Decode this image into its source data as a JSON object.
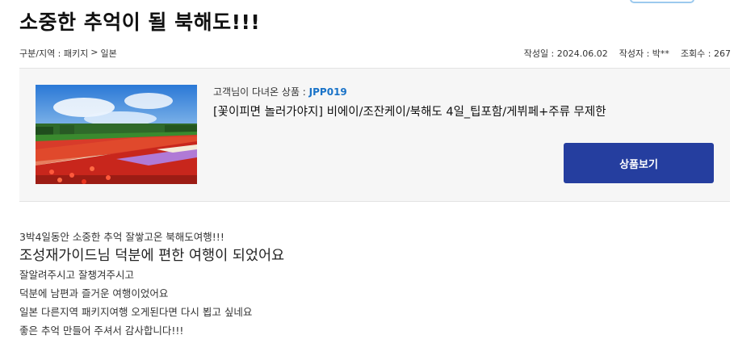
{
  "post": {
    "title": "소중한 추억이 될 북해도!!!",
    "breadcrumb": {
      "category": "구분/지역 : 패키지",
      "separator": ">",
      "region": "일본"
    },
    "date_label": "작성일 : 2024.06.02",
    "author_label": "작성자 : 박**",
    "views_label": "조회수 : 267"
  },
  "product": {
    "visited_label": "고객님이 다녀온 상품 : ",
    "code": "JPP019",
    "name": "[꽃이피면 놀러가야지] 비에이/조잔케이/북해도 4일_팁포함/게뷔페+주류 무제한",
    "button_label": "상품보기",
    "image_desc": "flower-field-photo"
  },
  "content": {
    "lines": [
      "3박4일동안 소중한 추억 잘쌓고온 북해도여행!!!",
      "조성재가이드님 덕분에 편한 여행이 되었어요",
      "잘알려주시고 잘챙겨주시고",
      "덕분에 남편과 즐거운 여행이었어요",
      "일본 다른지역 패키지여행 오게된다면 다시 뵙고 싶네요",
      "좋은 추억 만들어 주셔서 감사합니다!!!"
    ]
  },
  "colors": {
    "accent": "#253e9f",
    "code": "#1a73c8"
  }
}
